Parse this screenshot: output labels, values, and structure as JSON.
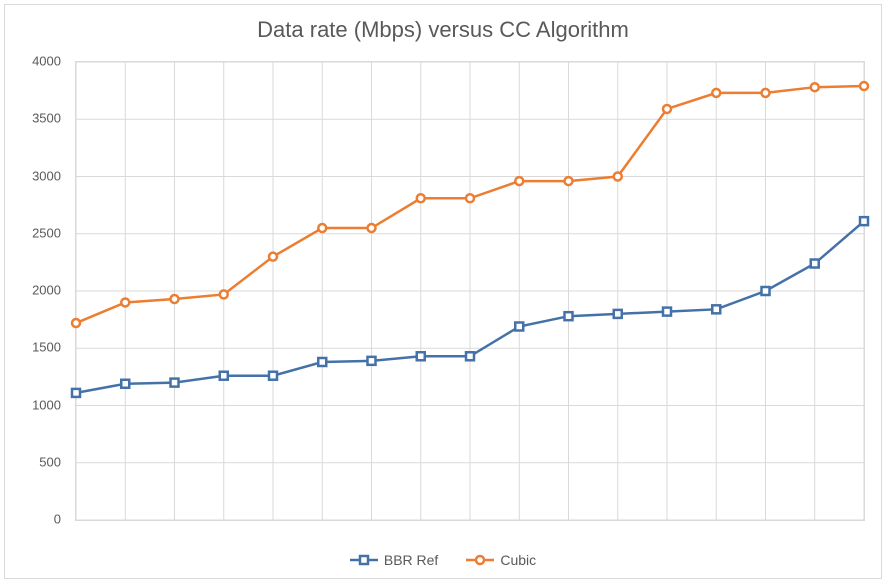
{
  "chart_data": {
    "type": "line",
    "title": "Data rate (Mbps) versus CC Algorithm",
    "xlabel": "",
    "ylabel": "",
    "ylim": [
      0,
      4000
    ],
    "ytick_step": 500,
    "x": [
      1,
      2,
      3,
      4,
      5,
      6,
      7,
      8,
      9,
      10,
      11,
      12,
      13,
      14,
      15,
      16,
      17
    ],
    "series": [
      {
        "name": "BBR Ref",
        "color": "#4472A8",
        "marker": "square",
        "values": [
          1110,
          1190,
          1200,
          1260,
          1260,
          1380,
          1390,
          1430,
          1430,
          1690,
          1780,
          1800,
          1820,
          1840,
          2000,
          2240,
          2610
        ]
      },
      {
        "name": "Cubic",
        "color": "#ED7D31",
        "marker": "circle",
        "values": [
          1720,
          1900,
          1930,
          1970,
          2300,
          2550,
          2550,
          2810,
          2810,
          2960,
          2960,
          3000,
          3590,
          3730,
          3730,
          3780,
          3790
        ]
      }
    ]
  }
}
